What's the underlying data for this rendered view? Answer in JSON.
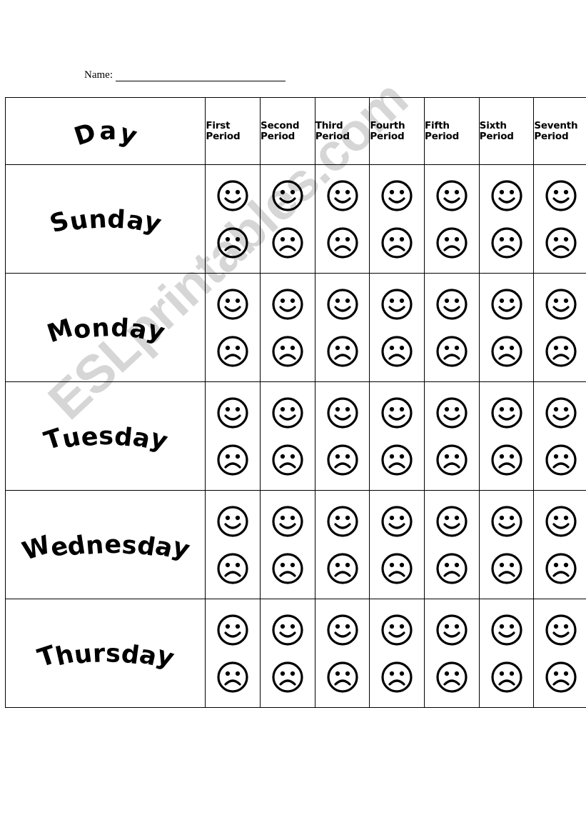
{
  "page": {
    "background_color": "#ffffff",
    "ink_color": "#000000"
  },
  "name_field": {
    "label": "Name:",
    "value": "",
    "placeholder": ""
  },
  "watermark": {
    "text": "ESLprintables.com",
    "color": "#cccccc"
  },
  "table": {
    "corner_header": "Day",
    "column_headers": [
      {
        "ordinal": "First",
        "unit": "Period"
      },
      {
        "ordinal": "Second",
        "unit": "Period"
      },
      {
        "ordinal": "Third",
        "unit": "Period"
      },
      {
        "ordinal": "Fourth",
        "unit": "Period"
      },
      {
        "ordinal": "Fifth",
        "unit": "Period"
      },
      {
        "ordinal": "Sixth",
        "unit": "Period"
      },
      {
        "ordinal": "Seventh",
        "unit": "Period"
      }
    ],
    "rows": [
      {
        "day": "Sunday",
        "cells": [
          "happy-sad",
          "happy-sad",
          "happy-sad",
          "happy-sad",
          "happy-sad",
          "happy-sad",
          "happy-sad"
        ]
      },
      {
        "day": "Monday",
        "cells": [
          "happy-sad",
          "happy-sad",
          "happy-sad",
          "happy-sad",
          "happy-sad",
          "happy-sad",
          "happy-sad"
        ]
      },
      {
        "day": "Tuesday",
        "cells": [
          "happy-sad",
          "happy-sad",
          "happy-sad",
          "happy-sad",
          "happy-sad",
          "happy-sad",
          "happy-sad"
        ]
      },
      {
        "day": "Wednesday",
        "cells": [
          "happy-sad",
          "happy-sad",
          "happy-sad",
          "happy-sad",
          "happy-sad",
          "happy-sad",
          "happy-sad"
        ]
      },
      {
        "day": "Thursday",
        "cells": [
          "happy-sad",
          "happy-sad",
          "happy-sad",
          "happy-sad",
          "happy-sad",
          "happy-sad",
          "happy-sad"
        ]
      }
    ],
    "icons": {
      "happy": "smiley-happy-face-icon",
      "sad": "smiley-sad-face-icon"
    }
  }
}
